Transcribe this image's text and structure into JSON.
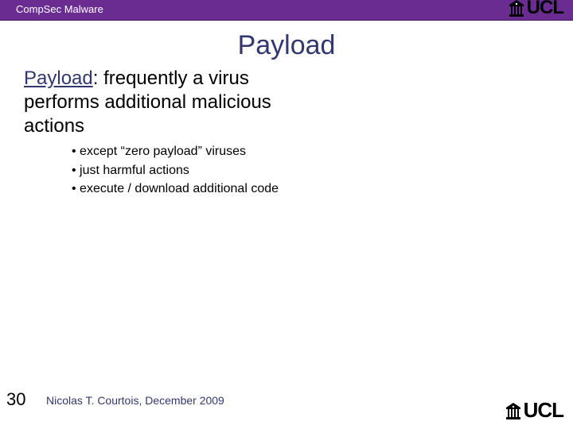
{
  "header": {
    "title": "CompSec Malware"
  },
  "title": "Payload",
  "body": {
    "label": "Payload",
    "rest": ": frequently a virus performs additional malicious actions"
  },
  "bullets": [
    "except “zero payload” viruses",
    "just harmful actions",
    "execute / download additional code"
  ],
  "footer": {
    "page": "30",
    "author": "Nicolas T. Courtois, December 2009"
  },
  "logo": {
    "text": "UCL"
  }
}
